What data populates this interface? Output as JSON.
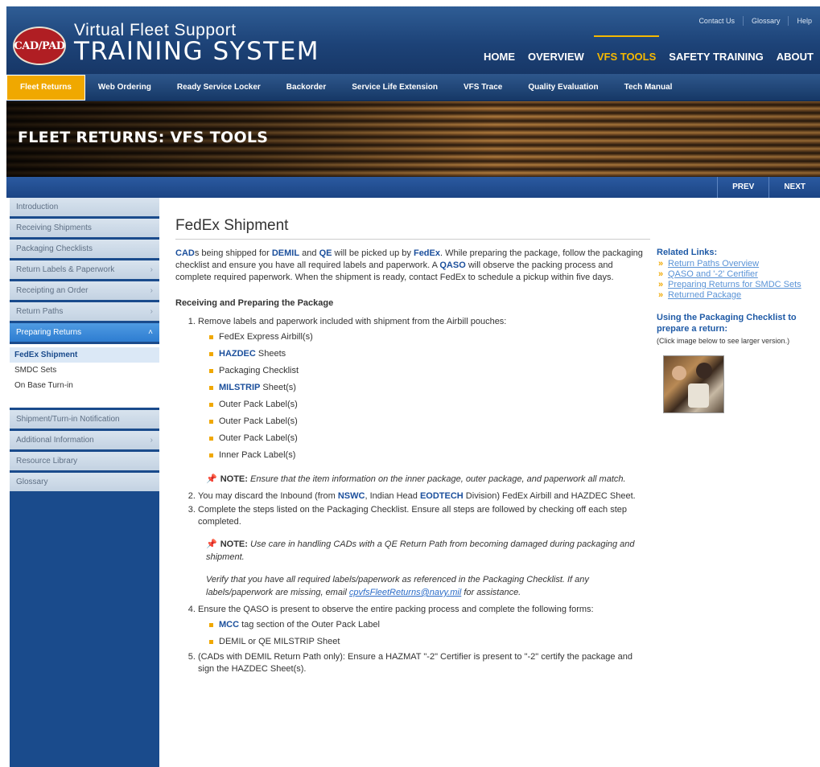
{
  "header": {
    "logo_text": "CAD/PAD",
    "title_line1": "Virtual Fleet Support",
    "title_line2": "TRAINING SYSTEM",
    "util_links": [
      "Contact Us",
      "Glossary",
      "Help"
    ],
    "main_nav": [
      {
        "label": "HOME",
        "active": false
      },
      {
        "label": "OVERVIEW",
        "active": false
      },
      {
        "label": "VFS TOOLS",
        "active": true
      },
      {
        "label": "SAFETY TRAINING",
        "active": false
      },
      {
        "label": "ABOUT",
        "active": false
      }
    ]
  },
  "subnav": [
    "Fleet Returns",
    "Web Ordering",
    "Ready Service Locker",
    "Backorder",
    "Service Life Extension",
    "VFS Trace",
    "Quality Evaluation",
    "Tech Manual"
  ],
  "banner": {
    "title": "FLEET RETURNS: VFS TOOLS"
  },
  "pager": {
    "prev": "PREV",
    "next": "NEXT"
  },
  "sidebar": {
    "items_top": [
      {
        "label": "Introduction",
        "chevron": ""
      },
      {
        "label": "Receiving Shipments",
        "chevron": ""
      },
      {
        "label": "Packaging Checklists",
        "chevron": ""
      },
      {
        "label": "Return Labels & Paperwork",
        "chevron": "›"
      },
      {
        "label": "Receipting an Order",
        "chevron": "›"
      },
      {
        "label": "Return Paths",
        "chevron": "›"
      },
      {
        "label": "Preparing Returns",
        "chevron": "˄"
      }
    ],
    "subitems": [
      "FedEx Shipment",
      "SMDC Sets",
      "On Base Turn-in"
    ],
    "items_bottom": [
      {
        "label": "Shipment/Turn-in Notification",
        "chevron": ""
      },
      {
        "label": "Additional Information",
        "chevron": "›"
      },
      {
        "label": "Resource Library",
        "chevron": ""
      },
      {
        "label": "Glossary",
        "chevron": ""
      }
    ]
  },
  "content": {
    "title": "FedEx Shipment",
    "intro": {
      "p1": "CAD",
      "p2": "s being shipped for ",
      "demil": "DEMIL",
      "p3": " and ",
      "qe": "QE",
      "p4": " will be picked up by ",
      "fedex": "FedEx",
      "p5": ". While preparing the package, follow the packaging checklist and ensure you have all required labels and paperwork. A ",
      "qaso": "QASO",
      "p6": " will observe the packing process and complete required paperwork. When the shipment is ready, contact FedEx to schedule a pickup within five days."
    },
    "section_heading": "Receiving and Preparing the Package",
    "step1": "Remove labels and paperwork included with shipment from the Airbill pouches:",
    "step1_bullets": [
      {
        "link": "",
        "text": "FedEx Express Airbill(s)"
      },
      {
        "link": "HAZDEC",
        "text": " Sheets"
      },
      {
        "link": "",
        "text": "Packaging Checklist"
      },
      {
        "link": "MILSTRIP",
        "text": " Sheet(s)"
      },
      {
        "link": "",
        "text": "Outer Pack Label(s)"
      },
      {
        "link": "",
        "text": "Outer Pack Label(s)"
      },
      {
        "link": "",
        "text": "Outer Pack Label(s)"
      },
      {
        "link": "",
        "text": "Inner Pack Label(s)"
      }
    ],
    "note1_label": "NOTE:",
    "note1_text": " Ensure that the item information on the inner package, outer package, and paperwork all match.",
    "step2": {
      "a": "You may discard the Inbound (from ",
      "nswc": "NSWC",
      "b": ", Indian Head ",
      "eodtech": "EODTECH",
      "c": " Division) FedEx Airbill and HAZDEC Sheet."
    },
    "step3": "Complete the steps listed on the Packaging Checklist. Ensure all steps are followed by checking off each step completed.",
    "note2_label": "NOTE:",
    "note2_text": " Use care in handling CADs with a QE Return Path from becoming damaged during packaging and shipment.",
    "note3_a": "Verify that you have all required labels/paperwork as referenced in the Packaging Checklist. If any labels/paperwork are missing, email ",
    "note3_email": "cpvfsFleetReturns@navy.mil",
    "note3_b": " for assistance.",
    "step4": "Ensure the QASO is present to observe the entire packing process and complete the following forms:",
    "step4_bullets": [
      {
        "link": "MCC",
        "text": " tag section of the Outer Pack Label"
      },
      {
        "link": "",
        "text": "DEMIL or QE MILSTRIP Sheet"
      }
    ],
    "step5": "(CADs with DEMIL Return Path only): Ensure a HAZMAT \"-2\" Certifier is present to \"-2\" certify the package and sign the HAZDEC Sheet(s)."
  },
  "related": {
    "heading": "Related Links:",
    "links": [
      "Return Paths Overview",
      "QASO and '-2' Certifier",
      "Preparing Returns for SMDC Sets",
      "Returned Package"
    ],
    "checklist_heading": "Using the Packaging Checklist to prepare a return:",
    "checklist_note": "(Click image below to see larger version.)"
  }
}
